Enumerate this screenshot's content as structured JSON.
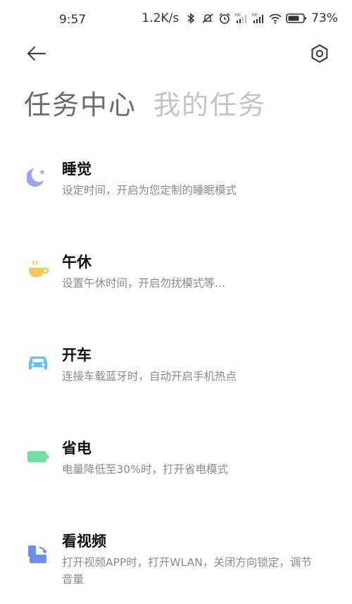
{
  "status_bar": {
    "time": "9:57",
    "network_speed": "1.2K/s",
    "battery": "73%",
    "icons": [
      "bluetooth-icon",
      "mute-icon",
      "alarm-icon",
      "signal-hd-icon",
      "signal-hd-icon",
      "wifi-icon",
      "battery-icon"
    ]
  },
  "header": {
    "back_icon": "back-arrow-icon",
    "settings_icon": "settings-hexagon-icon"
  },
  "tabs": [
    {
      "label": "任务中心",
      "active": true
    },
    {
      "label": "我的任务",
      "active": false
    }
  ],
  "tasks": [
    {
      "title": "睡觉",
      "desc": "设定时间，开启为您定制的睡眠模式",
      "icon": "moon-icon",
      "color": "#9fa6f0"
    },
    {
      "title": "午休",
      "desc": "设置午休时间，开启勿扰模式等...",
      "icon": "coffee-cup-icon",
      "color": "#f7c755"
    },
    {
      "title": "开车",
      "desc": "连接车载蓝牙时，自动开启手机热点",
      "icon": "car-icon",
      "color": "#5cc6f2"
    },
    {
      "title": "省电",
      "desc": "电量降低至30%时，打开省电模式",
      "icon": "battery-saver-icon",
      "color": "#6ee3a0"
    },
    {
      "title": "看视频",
      "desc": "打开视频APP时，打开WLAN，关闭方向锁定，调节音量",
      "icon": "video-rotate-icon",
      "color": "#6f8df0"
    }
  ]
}
